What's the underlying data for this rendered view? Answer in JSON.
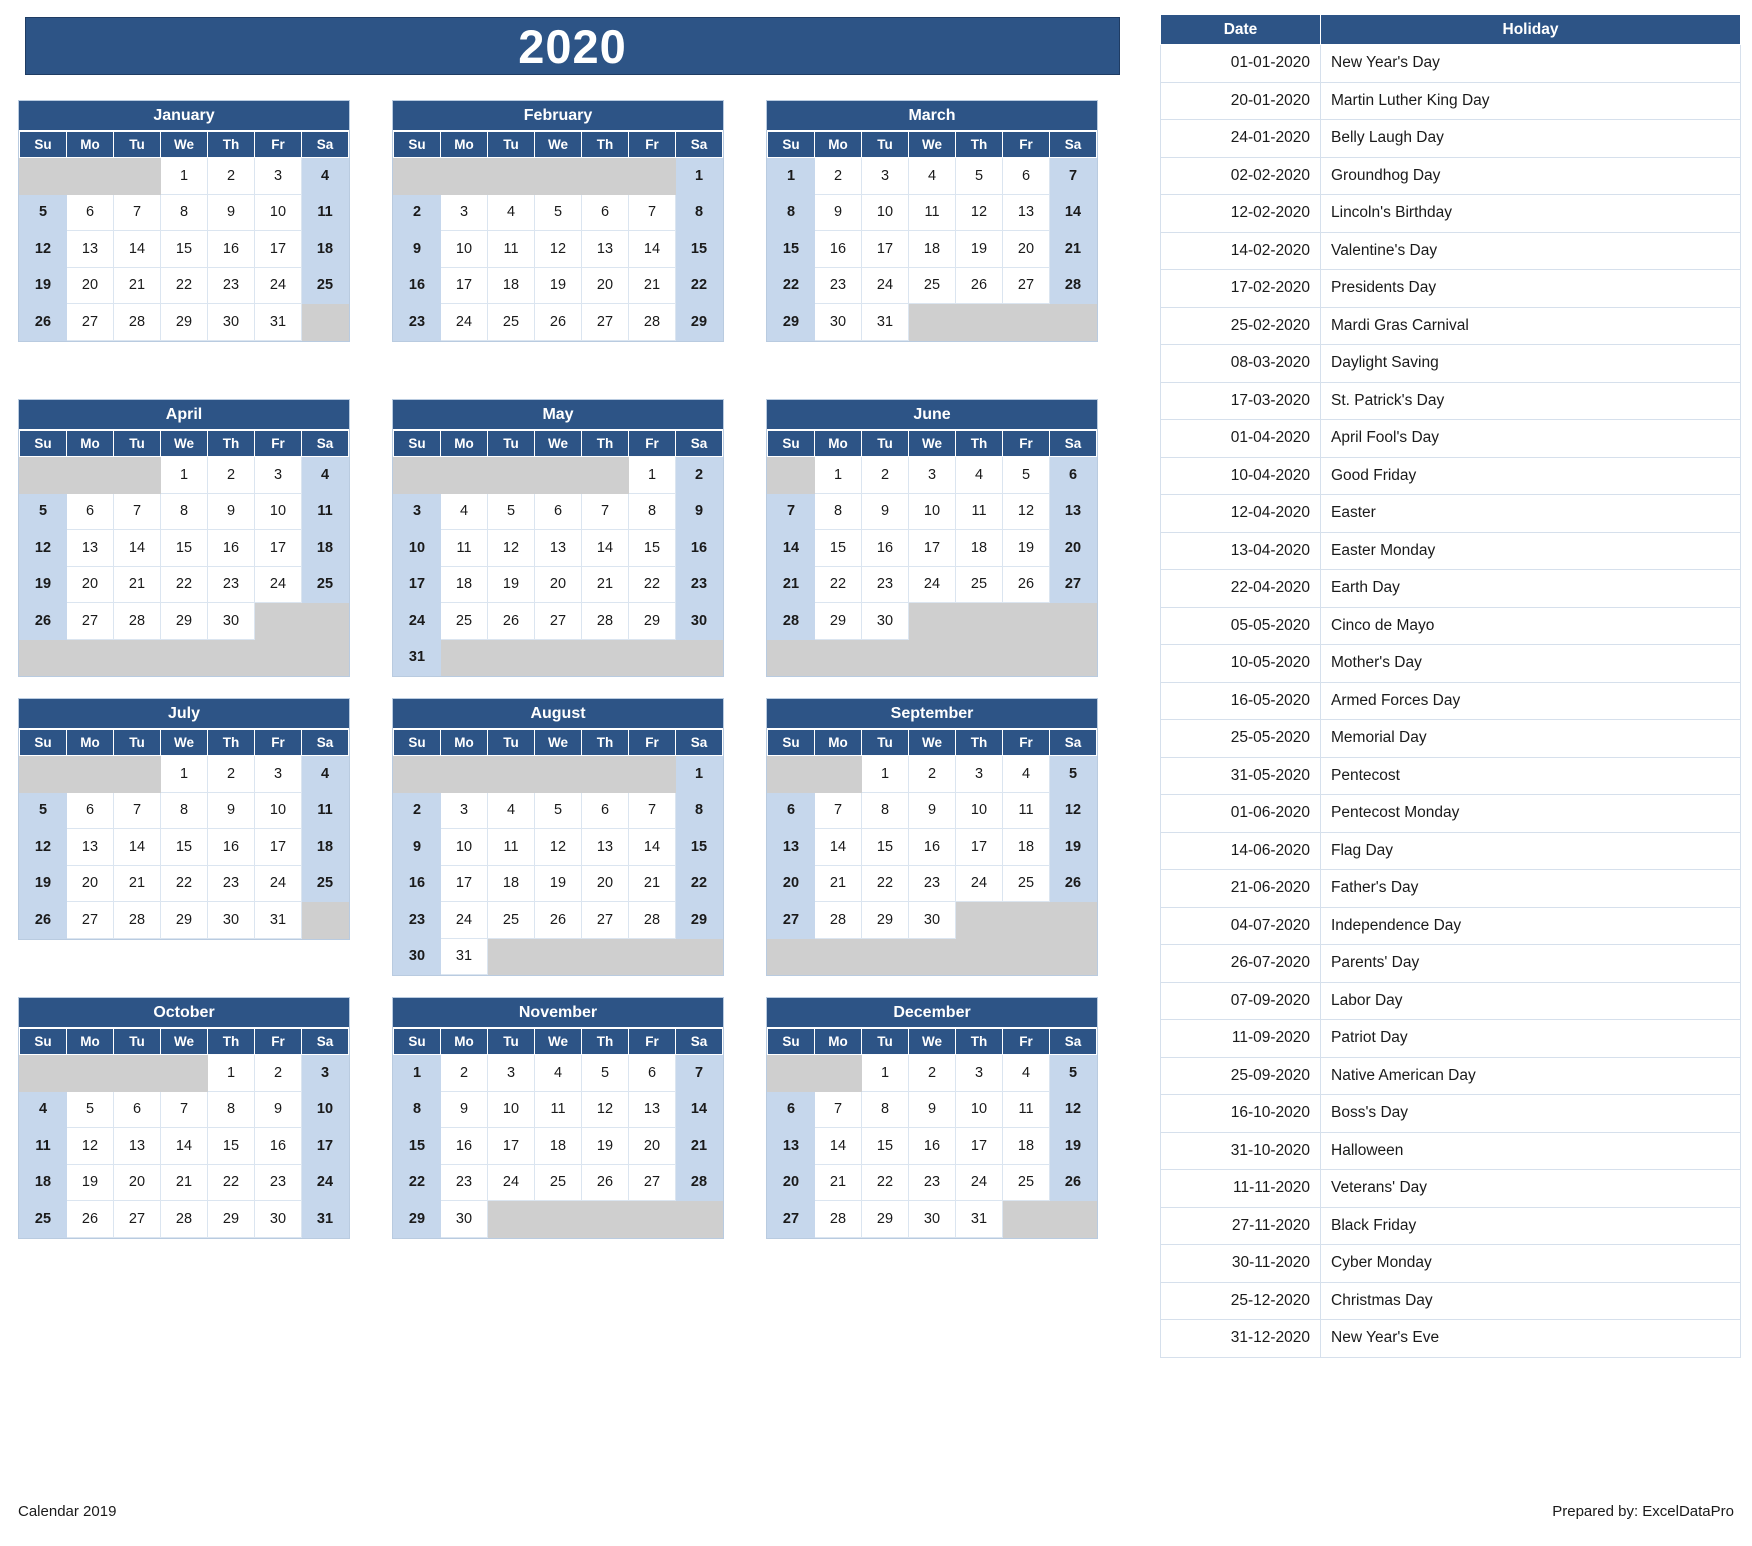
{
  "title": "2020",
  "colors": {
    "header_blue": "#2d5486",
    "weekend_blue": "#c6d7ec",
    "blank_gray": "#cfcfcf",
    "grid_line": "#dbe5f0"
  },
  "weekday_headers": [
    "Su",
    "Mo",
    "Tu",
    "We",
    "Th",
    "Fr",
    "Sa"
  ],
  "months": [
    {
      "name": "January",
      "weeks": [
        [
          "",
          "",
          "",
          "1",
          "2",
          "3",
          "4"
        ],
        [
          "5",
          "6",
          "7",
          "8",
          "9",
          "10",
          "11"
        ],
        [
          "12",
          "13",
          "14",
          "15",
          "16",
          "17",
          "18"
        ],
        [
          "19",
          "20",
          "21",
          "22",
          "23",
          "24",
          "25"
        ],
        [
          "26",
          "27",
          "28",
          "29",
          "30",
          "31",
          ""
        ]
      ]
    },
    {
      "name": "February",
      "weeks": [
        [
          "",
          "",
          "",
          "",
          "",
          "",
          "1"
        ],
        [
          "2",
          "3",
          "4",
          "5",
          "6",
          "7",
          "8"
        ],
        [
          "9",
          "10",
          "11",
          "12",
          "13",
          "14",
          "15"
        ],
        [
          "16",
          "17",
          "18",
          "19",
          "20",
          "21",
          "22"
        ],
        [
          "23",
          "24",
          "25",
          "26",
          "27",
          "28",
          "29"
        ]
      ]
    },
    {
      "name": "March",
      "weeks": [
        [
          "1",
          "2",
          "3",
          "4",
          "5",
          "6",
          "7"
        ],
        [
          "8",
          "9",
          "10",
          "11",
          "12",
          "13",
          "14"
        ],
        [
          "15",
          "16",
          "17",
          "18",
          "19",
          "20",
          "21"
        ],
        [
          "22",
          "23",
          "24",
          "25",
          "26",
          "27",
          "28"
        ],
        [
          "29",
          "30",
          "31",
          "",
          "",
          "",
          ""
        ]
      ]
    },
    {
      "name": "April",
      "weeks": [
        [
          "",
          "",
          "",
          "1",
          "2",
          "3",
          "4"
        ],
        [
          "5",
          "6",
          "7",
          "8",
          "9",
          "10",
          "11"
        ],
        [
          "12",
          "13",
          "14",
          "15",
          "16",
          "17",
          "18"
        ],
        [
          "19",
          "20",
          "21",
          "22",
          "23",
          "24",
          "25"
        ],
        [
          "26",
          "27",
          "28",
          "29",
          "30",
          "",
          ""
        ],
        [
          "",
          "",
          "",
          "",
          "",
          "",
          ""
        ]
      ]
    },
    {
      "name": "May",
      "weeks": [
        [
          "",
          "",
          "",
          "",
          "",
          "1",
          "2"
        ],
        [
          "3",
          "4",
          "5",
          "6",
          "7",
          "8",
          "9"
        ],
        [
          "10",
          "11",
          "12",
          "13",
          "14",
          "15",
          "16"
        ],
        [
          "17",
          "18",
          "19",
          "20",
          "21",
          "22",
          "23"
        ],
        [
          "24",
          "25",
          "26",
          "27",
          "28",
          "29",
          "30"
        ],
        [
          "31",
          "",
          "",
          "",
          "",
          "",
          ""
        ]
      ]
    },
    {
      "name": "June",
      "weeks": [
        [
          "",
          "1",
          "2",
          "3",
          "4",
          "5",
          "6"
        ],
        [
          "7",
          "8",
          "9",
          "10",
          "11",
          "12",
          "13"
        ],
        [
          "14",
          "15",
          "16",
          "17",
          "18",
          "19",
          "20"
        ],
        [
          "21",
          "22",
          "23",
          "24",
          "25",
          "26",
          "27"
        ],
        [
          "28",
          "29",
          "30",
          "",
          "",
          "",
          ""
        ],
        [
          "",
          "",
          "",
          "",
          "",
          "",
          ""
        ]
      ]
    },
    {
      "name": "July",
      "weeks": [
        [
          "",
          "",
          "",
          "1",
          "2",
          "3",
          "4"
        ],
        [
          "5",
          "6",
          "7",
          "8",
          "9",
          "10",
          "11"
        ],
        [
          "12",
          "13",
          "14",
          "15",
          "16",
          "17",
          "18"
        ],
        [
          "19",
          "20",
          "21",
          "22",
          "23",
          "24",
          "25"
        ],
        [
          "26",
          "27",
          "28",
          "29",
          "30",
          "31",
          ""
        ]
      ]
    },
    {
      "name": "August",
      "weeks": [
        [
          "",
          "",
          "",
          "",
          "",
          "",
          "1"
        ],
        [
          "2",
          "3",
          "4",
          "5",
          "6",
          "7",
          "8"
        ],
        [
          "9",
          "10",
          "11",
          "12",
          "13",
          "14",
          "15"
        ],
        [
          "16",
          "17",
          "18",
          "19",
          "20",
          "21",
          "22"
        ],
        [
          "23",
          "24",
          "25",
          "26",
          "27",
          "28",
          "29"
        ],
        [
          "30",
          "31",
          "",
          "",
          "",
          "",
          ""
        ]
      ]
    },
    {
      "name": "September",
      "weeks": [
        [
          "",
          "",
          "1",
          "2",
          "3",
          "4",
          "5"
        ],
        [
          "6",
          "7",
          "8",
          "9",
          "10",
          "11",
          "12"
        ],
        [
          "13",
          "14",
          "15",
          "16",
          "17",
          "18",
          "19"
        ],
        [
          "20",
          "21",
          "22",
          "23",
          "24",
          "25",
          "26"
        ],
        [
          "27",
          "28",
          "29",
          "30",
          "",
          "",
          ""
        ],
        [
          "",
          "",
          "",
          "",
          "",
          "",
          ""
        ]
      ]
    },
    {
      "name": "October",
      "weeks": [
        [
          "",
          "",
          "",
          "",
          "1",
          "2",
          "3"
        ],
        [
          "4",
          "5",
          "6",
          "7",
          "8",
          "9",
          "10"
        ],
        [
          "11",
          "12",
          "13",
          "14",
          "15",
          "16",
          "17"
        ],
        [
          "18",
          "19",
          "20",
          "21",
          "22",
          "23",
          "24"
        ],
        [
          "25",
          "26",
          "27",
          "28",
          "29",
          "30",
          "31"
        ]
      ]
    },
    {
      "name": "November",
      "weeks": [
        [
          "1",
          "2",
          "3",
          "4",
          "5",
          "6",
          "7"
        ],
        [
          "8",
          "9",
          "10",
          "11",
          "12",
          "13",
          "14"
        ],
        [
          "15",
          "16",
          "17",
          "18",
          "19",
          "20",
          "21"
        ],
        [
          "22",
          "23",
          "24",
          "25",
          "26",
          "27",
          "28"
        ],
        [
          "29",
          "30",
          "",
          "",
          "",
          "",
          ""
        ]
      ]
    },
    {
      "name": "December",
      "weeks": [
        [
          "",
          "",
          "1",
          "2",
          "3",
          "4",
          "5"
        ],
        [
          "6",
          "7",
          "8",
          "9",
          "10",
          "11",
          "12"
        ],
        [
          "13",
          "14",
          "15",
          "16",
          "17",
          "18",
          "19"
        ],
        [
          "20",
          "21",
          "22",
          "23",
          "24",
          "25",
          "26"
        ],
        [
          "27",
          "28",
          "29",
          "30",
          "31",
          "",
          ""
        ]
      ]
    }
  ],
  "holiday_table": {
    "headers": [
      "Date",
      "Holiday"
    ],
    "rows": [
      [
        "01-01-2020",
        "New Year's Day"
      ],
      [
        "20-01-2020",
        "Martin Luther King Day"
      ],
      [
        "24-01-2020",
        "Belly Laugh Day"
      ],
      [
        "02-02-2020",
        "Groundhog Day"
      ],
      [
        "12-02-2020",
        "Lincoln's Birthday"
      ],
      [
        "14-02-2020",
        "Valentine's Day"
      ],
      [
        "17-02-2020",
        "Presidents Day"
      ],
      [
        "25-02-2020",
        "Mardi Gras Carnival"
      ],
      [
        "08-03-2020",
        "Daylight Saving"
      ],
      [
        "17-03-2020",
        "St. Patrick's Day"
      ],
      [
        "01-04-2020",
        "April Fool's Day"
      ],
      [
        "10-04-2020",
        "Good Friday"
      ],
      [
        "12-04-2020",
        "Easter"
      ],
      [
        "13-04-2020",
        "Easter Monday"
      ],
      [
        "22-04-2020",
        "Earth Day"
      ],
      [
        "05-05-2020",
        "Cinco de Mayo"
      ],
      [
        "10-05-2020",
        "Mother's Day"
      ],
      [
        "16-05-2020",
        "Armed Forces Day"
      ],
      [
        "25-05-2020",
        "Memorial Day"
      ],
      [
        "31-05-2020",
        "Pentecost"
      ],
      [
        "01-06-2020",
        "Pentecost Monday"
      ],
      [
        "14-06-2020",
        "Flag Day"
      ],
      [
        "21-06-2020",
        "Father's Day"
      ],
      [
        "04-07-2020",
        "Independence Day"
      ],
      [
        "26-07-2020",
        "Parents' Day"
      ],
      [
        "07-09-2020",
        "Labor Day"
      ],
      [
        "11-09-2020",
        "Patriot Day"
      ],
      [
        "25-09-2020",
        "Native American Day"
      ],
      [
        "16-10-2020",
        "Boss's Day"
      ],
      [
        "31-10-2020",
        "Halloween"
      ],
      [
        "11-11-2020",
        "Veterans' Day"
      ],
      [
        "27-11-2020",
        "Black Friday"
      ],
      [
        "30-11-2020",
        "Cyber Monday"
      ],
      [
        "25-12-2020",
        "Christmas Day"
      ],
      [
        "31-12-2020",
        "New Year's Eve"
      ]
    ]
  },
  "footer": {
    "left": "Calendar 2019",
    "right": "Prepared by: ExcelDataPro"
  }
}
